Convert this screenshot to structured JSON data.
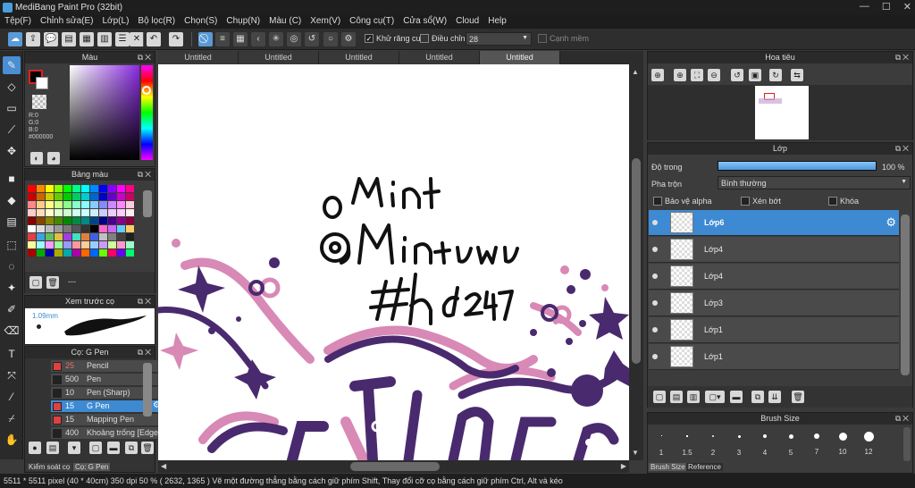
{
  "window": {
    "title": "MediBang Paint Pro (32bit)"
  },
  "menu": [
    "Tệp(F)",
    "Chỉnh sửa(E)",
    "Lớp(L)",
    "Bộ lọc(R)",
    "Chọn(S)",
    "Chụp(N)",
    "Màu (C)",
    "Xem(V)",
    "Công cụ(T)",
    "Cửa sổ(W)",
    "Cloud",
    "Help"
  ],
  "toolbar": {
    "antialias_label": "Khử răng cưa",
    "adjust_label": "Điều chỉnh",
    "adjust_value": "28",
    "smooth_label": "Cạnh mềm"
  },
  "color_panel": {
    "title": "Màu",
    "r": "R:0",
    "g": "G:0",
    "b": "B:0",
    "hex": "#000000"
  },
  "palette_panel": {
    "title": "Bảng màu",
    "footer": "---"
  },
  "preview_panel": {
    "title": "Xem trước cọ",
    "size": "1.09mm"
  },
  "brush_panel": {
    "title": "Cọ: G Pen",
    "tab1": "Kiểm soát cọ",
    "tab2": "Cọ: G Pen",
    "items": [
      {
        "size": "25",
        "name": "Pencil",
        "color": "#e04040"
      },
      {
        "size": "500",
        "name": "Pen",
        "color": "#222222"
      },
      {
        "size": "10",
        "name": "Pen (Sharp)",
        "color": "#222222"
      },
      {
        "size": "15",
        "name": "G Pen",
        "color": "#e04040"
      },
      {
        "size": "15",
        "name": "Mapping Pen",
        "color": "#e04040"
      },
      {
        "size": "400",
        "name": "Khoảng trống [Edge]",
        "color": "#222222"
      }
    ]
  },
  "tabs": [
    "Untitled",
    "Untitled",
    "Untitled",
    "Untitled",
    "Untitled"
  ],
  "canvas": {
    "lines": [
      "Mint",
      "@MintUwU",
      "#hd247"
    ]
  },
  "navigator": {
    "title": "Hoa tiêu"
  },
  "layer_panel": {
    "title": "Lớp",
    "opacity_label": "Độ trong",
    "opacity_value": "100 %",
    "opacity_pct": 100,
    "blend_label": "Pha trộn",
    "blend_value": "Bình thường",
    "protect_alpha": "Bảo vệ alpha",
    "clip": "Xén bớt",
    "lock": "Khóa",
    "layers": [
      "Lớp6",
      "Lớp4",
      "Lớp4",
      "Lớp3",
      "Lớp1",
      "Lớp1"
    ]
  },
  "brush_size_panel": {
    "title": "Brush Size",
    "sizes": [
      "1",
      "1.5",
      "2",
      "3",
      "4",
      "5",
      "7",
      "10",
      "12"
    ],
    "tab1": "Brush Size",
    "tab2": "Reference"
  },
  "status": "5511 * 5511 pixel  (40 * 40cm)  350 dpi  50 %  ( 2632, 1365 )  Vẽ một đường thẳng bằng cách giữ phím Shift, Thay đổi cỡ cọ bằng cách giữ phím Ctrl, Alt và kéo",
  "colors": {
    "accent": "#3d8ad2",
    "ink": "#4a2a6e",
    "pink": "#d889b6"
  }
}
